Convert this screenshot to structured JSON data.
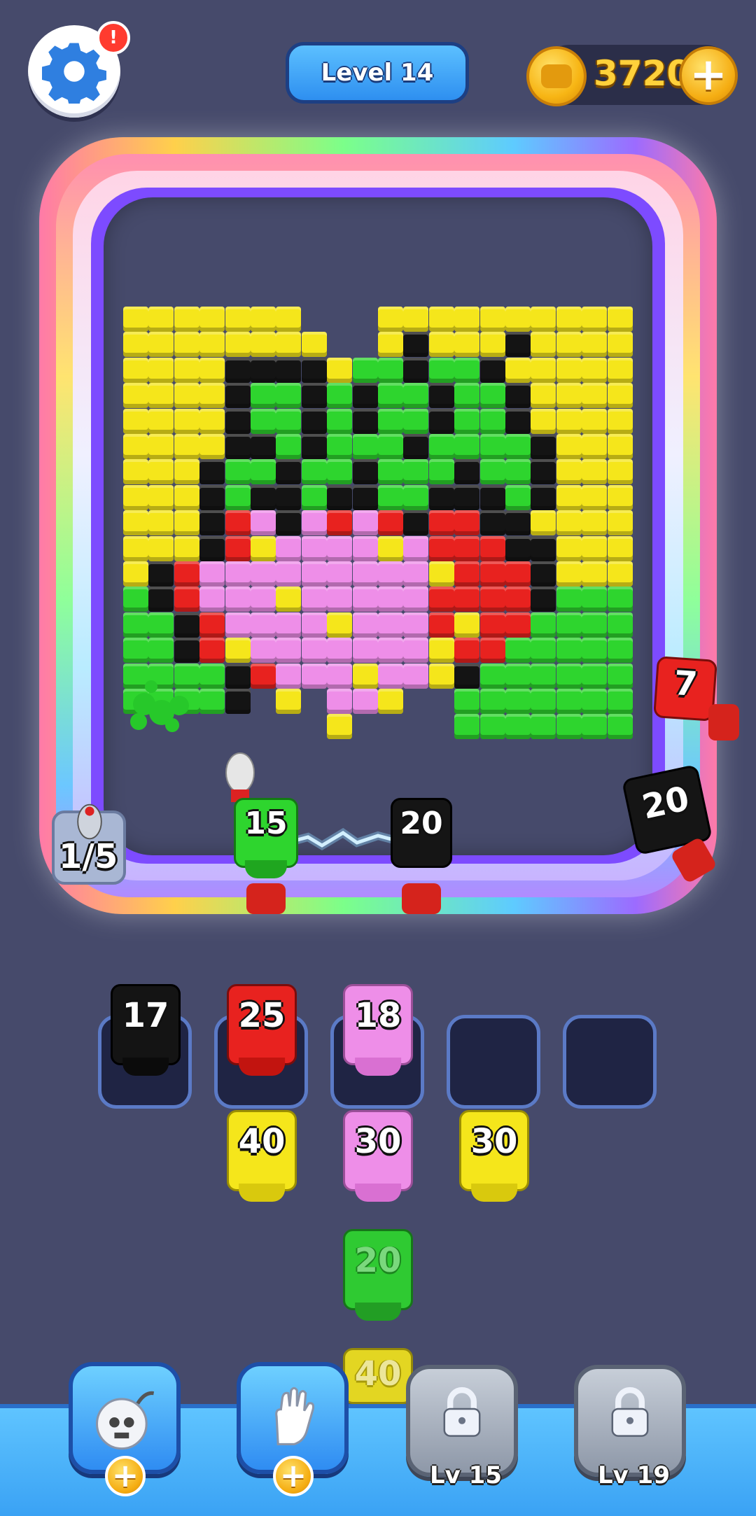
{
  "header": {
    "level_label": "Level 14",
    "coins": "3720",
    "settings_alert": "!"
  },
  "board": {
    "ammo_counter": "1/5",
    "rail_shooters": [
      {
        "value": "7",
        "color": "#e8221f"
      },
      {
        "value": "20",
        "color": "#111111"
      },
      {
        "value": "15",
        "color": "#2ed52e"
      },
      {
        "value": "20",
        "color": "#111111"
      }
    ]
  },
  "queue": {
    "slots": [
      {
        "value": "17",
        "color": "#111111"
      },
      {
        "value": "25",
        "color": "#e8221f"
      },
      {
        "value": "18",
        "color": "#ee8ee8"
      },
      {
        "value": "",
        "color": ""
      },
      {
        "value": "",
        "color": ""
      }
    ],
    "reserve": [
      {
        "value": "40",
        "color": "#f5e61b"
      },
      {
        "value": "30",
        "color": "#ee8ee8"
      },
      {
        "value": "30",
        "color": "#f5e61b"
      },
      {
        "value": "20",
        "color": "#2ed52e"
      },
      {
        "value": "40",
        "color": "#f5e61b"
      }
    ]
  },
  "tools": [
    {
      "name": "bomb",
      "state": "active"
    },
    {
      "name": "glove",
      "state": "active"
    },
    {
      "name": "locked",
      "level_label": "Lv 15"
    },
    {
      "name": "locked",
      "level_label": "Lv 19"
    }
  ],
  "colors": {
    "yellow": "#f5e61b",
    "green": "#2ed52e",
    "black": "#141414",
    "red": "#e8221f",
    "pink": "#ee8ee8",
    "background": "#464a6b"
  }
}
